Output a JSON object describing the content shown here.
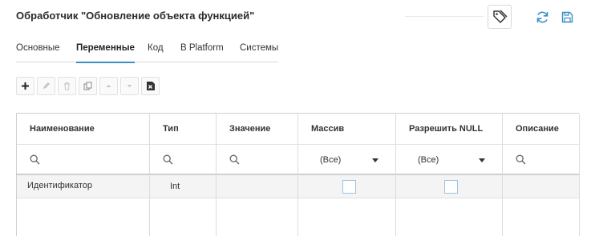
{
  "header": {
    "title": "Обработчик \"Обновление объекта функцией\"",
    "icons": [
      "tags-icon",
      "refresh-icon",
      "save-icon"
    ],
    "accent_color": "#3a8ec5"
  },
  "tabs": [
    {
      "label": "Основные",
      "active": false
    },
    {
      "label": "Переменные",
      "active": true
    },
    {
      "label": "Код",
      "active": false
    },
    {
      "label": "В Platform",
      "active": false
    },
    {
      "label": "Системы",
      "active": false
    }
  ],
  "toolbar": {
    "buttons": [
      {
        "icon": "plus-icon",
        "enabled": true
      },
      {
        "icon": "pencil-icon",
        "enabled": false
      },
      {
        "icon": "trash-icon",
        "enabled": false
      },
      {
        "icon": "copy-icon",
        "enabled": false
      },
      {
        "icon": "arrow-up-icon",
        "enabled": false
      },
      {
        "icon": "arrow-down-icon",
        "enabled": false
      },
      {
        "icon": "excel-icon",
        "enabled": true
      }
    ]
  },
  "grid": {
    "columns": [
      {
        "label": "Наименование",
        "filter": "search"
      },
      {
        "label": "Тип",
        "filter": "search"
      },
      {
        "label": "Значение",
        "filter": "search"
      },
      {
        "label": "Массив",
        "filter": "select",
        "filter_value": "(Все)"
      },
      {
        "label": "Разрешить NULL",
        "filter": "select",
        "filter_value": "(Все)"
      },
      {
        "label": "Описание",
        "filter": "search"
      }
    ],
    "rows": [
      {
        "name": "Идентификатор",
        "type": "Int",
        "value": "",
        "array": false,
        "allow_null": false,
        "description": ""
      }
    ]
  }
}
